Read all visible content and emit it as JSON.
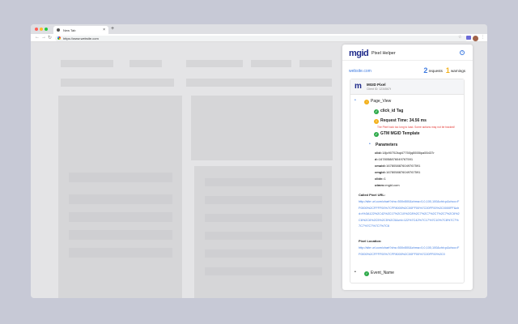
{
  "browser": {
    "tab_title": "New Tab",
    "url": "https://www.website.com"
  },
  "panel": {
    "logo": "mgid",
    "title": "Pixel Helper",
    "site": "website.com",
    "requests_count": "2",
    "requests_label": "requests",
    "warnings_count": "1",
    "warnings_label": "warnings",
    "pixel": {
      "title": "MGID Pixel",
      "client_id": "Client ID: 1234567t"
    },
    "event": "Page_View",
    "checks": [
      "click_id Tag",
      "Request Time: 34.56 ms",
      "GTM MGID Template"
    ],
    "error": "The Pixel took too long to load. Some actions may not be tracked!",
    "params_title": "Parameters",
    "params": [
      {
        "k": "clid",
        "v": "18jc90752kqi47750jq5555ipa55437r"
      },
      {
        "k": "d",
        "v": "1678058876049767591"
      },
      {
        "k": "cmuid",
        "v": "1678058876049767591"
      },
      {
        "k": "cmgid",
        "v": "1678058876049767591"
      },
      {
        "k": "clidv",
        "v": "1"
      },
      {
        "k": "utmm",
        "v": "mgid.com"
      }
    ],
    "called_url_label": "Called Pixel URL:",
    "called_url": "http://site url.com/chart?chs=500x500&chma=0,0,100,100&cht=p&chco=FF0000%2CFFFF00%7CFF8000%2C00FF00%7C00FF00%2C0000FF&chd=t%3A122%2C42%2C17%2C10%2C8%2C7%2C7%2C7%2C7%2C6%2C6%2C6%2C5%2C5%2C5&chl=122%7C42%7C17%7C10%7C8%7C7%7C7%7C7%7C7%7C6",
    "location_label": "Pixel Location:",
    "location_url": "http://site url.com/chart?chs=500x500&chma=0,0,100,100&cht=p&chco=FF0000%2CFFFF00%7CFF8000%2C00FF00%7C00FF00%2C0",
    "event2": "Event_Name"
  }
}
